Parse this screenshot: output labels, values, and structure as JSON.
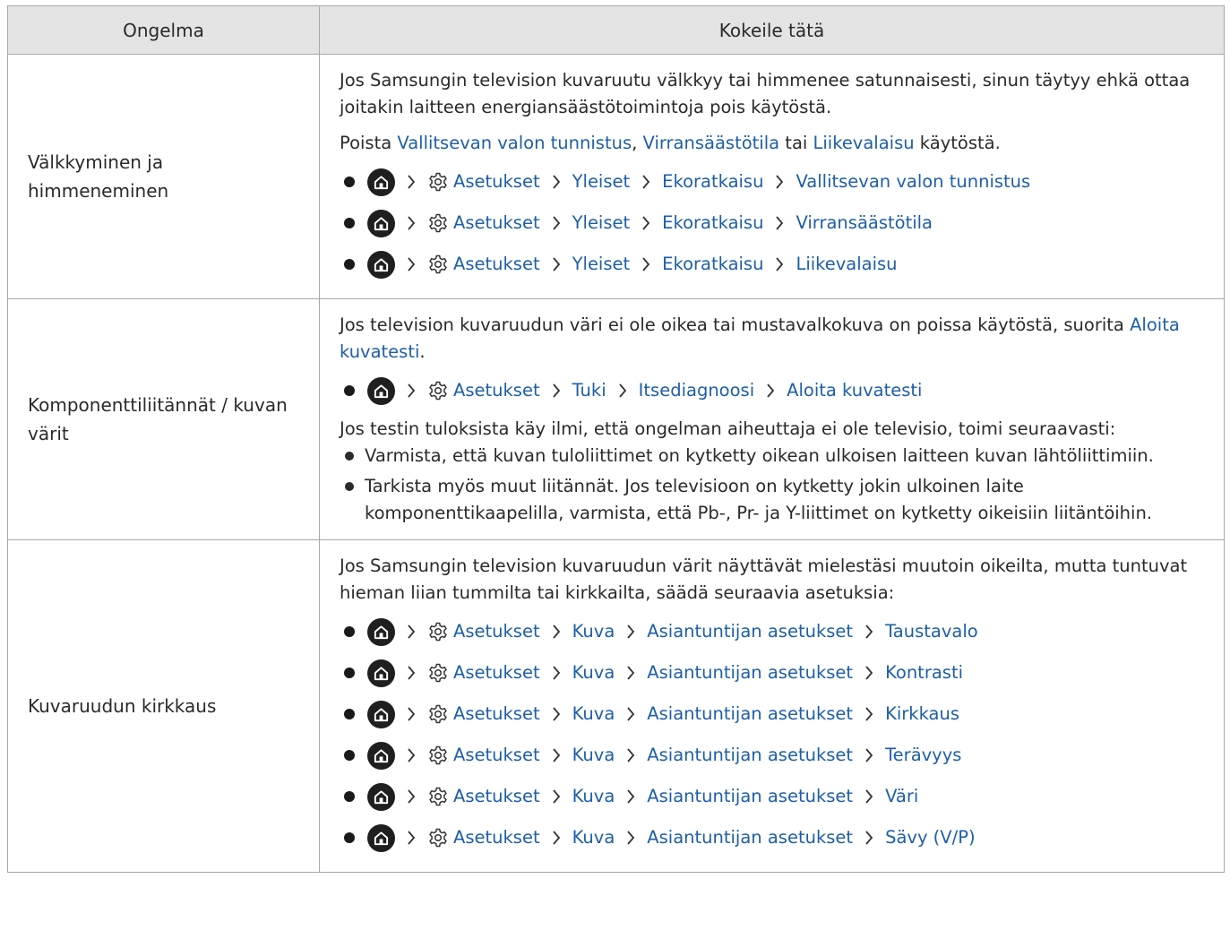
{
  "header": {
    "col1": "Ongelma",
    "col2": "Kokeile tätä"
  },
  "crumb": {
    "settings": "Asetukset",
    "general": "Yleiset",
    "eco": "Ekoratkaisu",
    "support": "Tuki",
    "selfdiag": "Itsediagnoosi",
    "picture": "Kuva",
    "expert": "Asiantuntijan asetukset"
  },
  "rows": [
    {
      "problem": "Välkkyminen ja himmeneminen",
      "intro": "Jos Samsungin television kuvaruutu välkkyy tai himmenee satunnaisesti, sinun täytyy ehkä ottaa joitakin laitteen energiansäästötoimintoja pois käytöstä.",
      "line2": {
        "pre": "Poista ",
        "l1": "Vallitsevan valon tunnistus",
        "sep1": ", ",
        "l2": "Virransäästötila",
        "sep2": " tai ",
        "l3": "Liikevalaisu",
        "post": " käytöstä."
      },
      "targets": [
        "Vallitsevan valon tunnistus",
        "Virransäästötila",
        "Liikevalaisu"
      ]
    },
    {
      "problem": "Komponenttiliitännät / kuvan värit",
      "intro": "Jos television kuvaruudun väri ei ole oikea tai mustavalkokuva on poissa käytöstä, suorita ",
      "intro_link": "Aloita kuvatesti",
      "intro_end": ".",
      "target": "Aloita kuvatesti",
      "followup": "Jos testin tuloksista käy ilmi, että ongelman aiheuttaja ei ole televisio, toimi seuraavasti:",
      "bullets": [
        "Varmista, että kuvan tuloliittimet on kytketty oikean ulkoisen laitteen kuvan lähtöliittimiin.",
        "Tarkista myös muut liitännät. Jos televisioon on kytketty jokin ulkoinen laite komponenttikaapelilla, varmista, että Pb-, Pr- ja Y-liittimet on kytketty oikeisiin liitäntöihin."
      ]
    },
    {
      "problem": "Kuvaruudun kirkkaus",
      "intro": "Jos Samsungin television kuvaruudun värit näyttävät mielestäsi muutoin oikeilta, mutta tuntuvat hieman liian tummilta tai kirkkailta, säädä seuraavia asetuksia:",
      "targets": [
        "Taustavalo",
        "Kontrasti",
        "Kirkkaus",
        "Terävyys",
        "Väri",
        "Sävy (V/P)"
      ]
    }
  ],
  "icons": {
    "home": "home-icon",
    "settings": "gear-icon",
    "separator": "chevron-right-icon"
  },
  "colors": {
    "link": "#1d5fa8",
    "header_bg": "#e4e4e4",
    "border": "#a8a8a8",
    "icon_bg": "#1f1f1f"
  }
}
